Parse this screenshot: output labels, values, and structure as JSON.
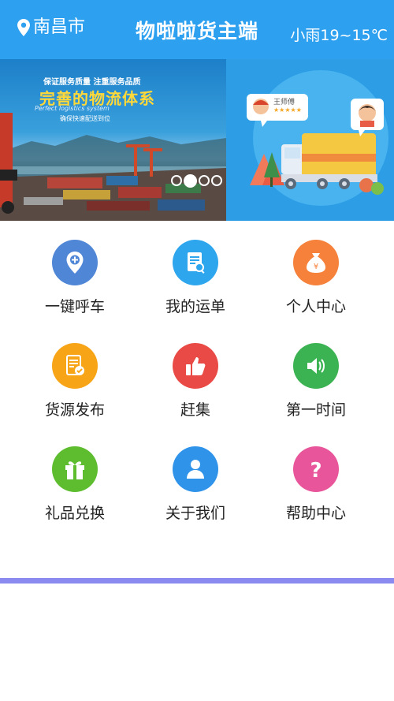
{
  "header": {
    "location": "南昌市",
    "title": "物啦啦货主端",
    "weather": "小雨19~15℃"
  },
  "banner": {
    "slide_left": {
      "line1": "保证服务质量 注重服务品质",
      "line2": "完善的物流体系",
      "line3": "Perfect logistics system",
      "line4": "确保快速配送到位"
    },
    "slide_right": {
      "driver_name": "王师傅",
      "rating": "★★★★★"
    },
    "active_dot": 1,
    "dot_count": 4
  },
  "menu": [
    {
      "label": "一键呼车",
      "icon": "location-plus-icon",
      "color": "#4f86d6"
    },
    {
      "label": "我的运单",
      "icon": "document-search-icon",
      "color": "#2ea6ee"
    },
    {
      "label": "个人中心",
      "icon": "money-bag-icon",
      "color": "#f5813a"
    },
    {
      "label": "货源发布",
      "icon": "document-check-icon",
      "color": "#f7a416"
    },
    {
      "label": "赶集",
      "icon": "thumbs-up-icon",
      "color": "#ea4a45"
    },
    {
      "label": "第一时间",
      "icon": "speaker-icon",
      "color": "#3bb352"
    },
    {
      "label": "礼品兑换",
      "icon": "gift-icon",
      "color": "#5ebd2f"
    },
    {
      "label": "关于我们",
      "icon": "user-icon",
      "color": "#2f93ea"
    },
    {
      "label": "帮助中心",
      "icon": "question-icon",
      "color": "#e8559a"
    }
  ]
}
